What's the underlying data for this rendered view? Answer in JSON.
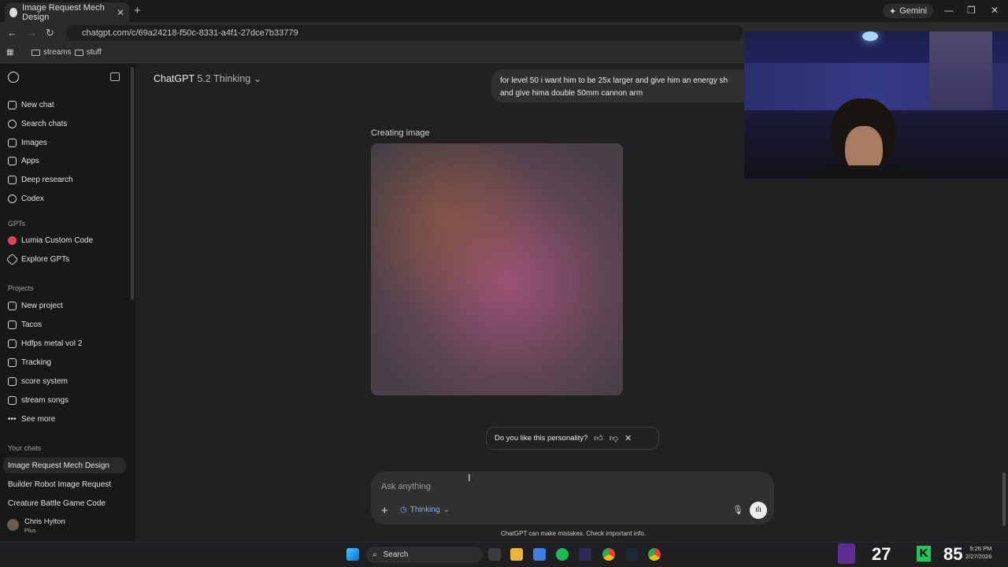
{
  "browser": {
    "tab_title": "Image Request Mech Design",
    "tab_close": "✕",
    "new_tab": "+",
    "gemini_label": "Gemini",
    "url": "chatgpt.com/c/69a24218-f50c-8331-a4f1-27dce7b33779",
    "bookmarks": [
      "streams",
      "stuff"
    ],
    "window_controls": {
      "minimize": "—",
      "maximize": "❐",
      "close": "✕"
    }
  },
  "sidebar": {
    "main_items": [
      {
        "label": "New chat",
        "icon": "edit-icon"
      },
      {
        "label": "Search chats",
        "icon": "search-icon"
      },
      {
        "label": "Images",
        "icon": "image-icon"
      },
      {
        "label": "Apps",
        "icon": "apps-icon"
      },
      {
        "label": "Deep research",
        "icon": "telescope-icon"
      },
      {
        "label": "Codex",
        "icon": "codex-icon"
      }
    ],
    "gpts_heading": "GPTs",
    "gpts": [
      {
        "label": "Lumia Custom Code",
        "icon": "gpt-avatar-icon"
      },
      {
        "label": "Explore GPTs",
        "icon": "explore-icon"
      }
    ],
    "projects_heading": "Projects",
    "projects": [
      {
        "label": "New project",
        "icon": "folder-plus-icon"
      },
      {
        "label": "Tacos",
        "icon": "folder-icon"
      },
      {
        "label": "Hdfps metal vol 2",
        "icon": "folder-icon"
      },
      {
        "label": "Tracking",
        "icon": "folder-icon"
      },
      {
        "label": "score system",
        "icon": "folder-icon"
      },
      {
        "label": "stream songs",
        "icon": "folder-icon"
      },
      {
        "label": "See more",
        "icon": "ellipsis-icon"
      }
    ],
    "chats_heading": "Your chats",
    "chats": [
      "Image Request Mech Design",
      "Builder Robot Image Request",
      "Creature Battle Game Code"
    ],
    "user": {
      "name": "Chris Hylton",
      "plan": "Plus"
    }
  },
  "main": {
    "model_name": "ChatGPT",
    "model_version": "5.2 Thinking",
    "user_message_line1": "for level 50 i want him to be 25x larger and give him an energy sh",
    "user_message_line2": "and give hima double 50mm cannon arm",
    "creating_label": "Creating image",
    "feedback_question": "Do you like this personality?",
    "composer_placeholder": "Ask anything",
    "mode_label": "Thinking",
    "disclaimer": "ChatGPT can make mistakes. Check important info."
  },
  "taskbar": {
    "search_label": "Search",
    "overlay_number_1": "27",
    "overlay_number_2": "85",
    "clock_time": "5:26 PM",
    "clock_date": "2/27/2026"
  },
  "colors": {
    "background": "#212121",
    "sidebar": "#181818",
    "composer": "#303030",
    "accent_thinking": "#7fb4ff"
  }
}
